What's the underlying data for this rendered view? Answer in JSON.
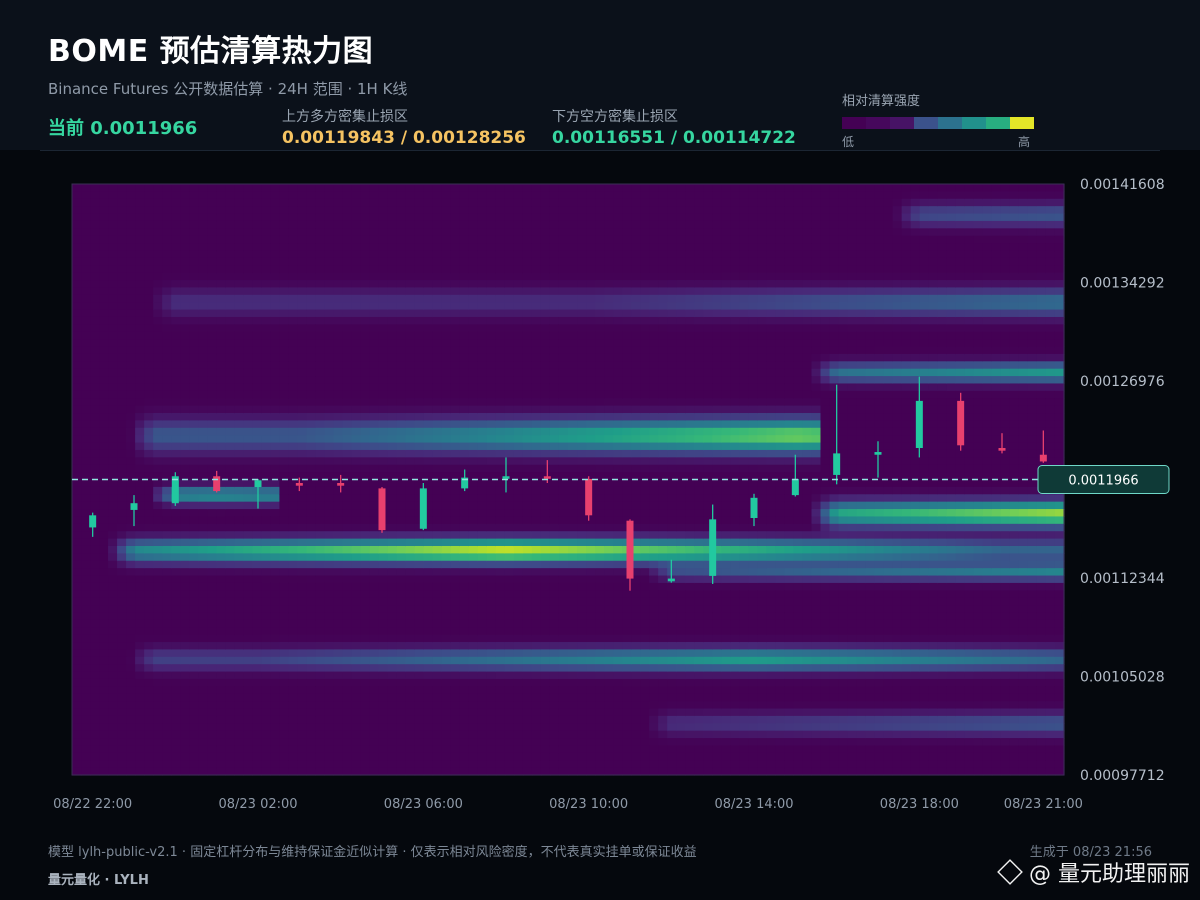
{
  "header": {
    "title": "BOME 预估清算热力图",
    "subtitle": "Binance Futures 公开数据估算 · 24H 范围 · 1H K线",
    "current_label": "当前 0.0011966",
    "upper_label": "上方多方密集止损区",
    "upper_value": "0.00119843 / 0.00128256",
    "lower_label": "下方空方密集止损区",
    "lower_value": "0.00116551 / 0.00114722",
    "legend_label": "相对清算强度",
    "legend_low": "低",
    "legend_high": "高"
  },
  "colors": {
    "up": "#22c9a0",
    "down": "#e8406e",
    "current_line": "#8fe8e0",
    "viridis": [
      "#440154",
      "#482878",
      "#3e4a89",
      "#31688e",
      "#26828e",
      "#1f9e89",
      "#35b779",
      "#6dcd59",
      "#b4de2c",
      "#fde725"
    ]
  },
  "legend_swatches": [
    "#440154",
    "#46085c",
    "#471365",
    "#3b528b",
    "#2c728e",
    "#21918c",
    "#28ae80",
    "#e4e628"
  ],
  "chart_data": {
    "type": "heatmap",
    "title": "BOME 预估清算热力图",
    "ylim": [
      0.00097712,
      0.00141608
    ],
    "y_ticks": [
      "0.00141608",
      "0.00134292",
      "0.00126976",
      "0.00119660",
      "0.00112344",
      "0.00105028",
      "0.00097712"
    ],
    "y_tick_labels_shown": [
      "0.00141608",
      "0.00134292",
      "0.00126976",
      "",
      "0.00112344",
      "0.00105028",
      "0.00097712"
    ],
    "x_tick_labels": [
      "08/22 22:00",
      "08/23 02:00",
      "08/23 06:00",
      "08/23 10:00",
      "08/23 14:00",
      "08/23 18:00",
      "08/23 21:00"
    ],
    "x_tick_hours": [
      0,
      4,
      8,
      12,
      16,
      20,
      23
    ],
    "x_range_hours": [
      -0.5,
      23.5
    ],
    "current_price": 0.0011966,
    "current_price_label": "0.0011966",
    "heat_bands": [
      {
        "price": 0.0011435,
        "x_start": 1,
        "x_end": 24,
        "peak": 10,
        "intensity": 1.0,
        "width": 8.5e-06
      },
      {
        "price": 0.001229,
        "x_start": 1.5,
        "x_end": 17,
        "peak": 17,
        "intensity": 0.85,
        "width": 1.2e-05
      },
      {
        "price": 0.001171,
        "x_start": 18,
        "x_end": 24,
        "peak": 24,
        "intensity": 0.95,
        "width": 9e-06
      },
      {
        "price": 0.001276,
        "x_start": 18,
        "x_end": 24,
        "peak": 24,
        "intensity": 0.6,
        "width": 7e-06
      },
      {
        "price": 0.001063,
        "x_start": 1.5,
        "x_end": 24,
        "peak": 16,
        "intensity": 0.6,
        "width": 8e-06
      },
      {
        "price": 0.001128,
        "x_start": 14,
        "x_end": 24,
        "peak": 24,
        "intensity": 0.5,
        "width": 6e-06
      },
      {
        "price": 0.001328,
        "x_start": 2,
        "x_end": 24,
        "peak": 24,
        "intensity": 0.4,
        "width": 1e-05
      },
      {
        "price": 0.001185,
        "x_start": 2,
        "x_end": 4,
        "peak": 3,
        "intensity": 0.55,
        "width": 6e-06
      },
      {
        "price": 0.001393,
        "x_start": 20,
        "x_end": 24,
        "peak": 24,
        "intensity": 0.3,
        "width": 8e-06
      },
      {
        "price": 0.001015,
        "x_start": 14,
        "x_end": 24,
        "peak": 24,
        "intensity": 0.3,
        "width": 8e-06
      }
    ],
    "candles": [
      {
        "h": 0,
        "o": 0.001161,
        "c": 0.00117,
        "hi": 0.001172,
        "lo": 0.001154
      },
      {
        "h": 1,
        "o": 0.001174,
        "c": 0.001179,
        "hi": 0.001185,
        "lo": 0.001162
      },
      {
        "h": 2,
        "o": 0.001179,
        "c": 0.001199,
        "hi": 0.001202,
        "lo": 0.001177
      },
      {
        "h": 3,
        "o": 0.001199,
        "c": 0.001188,
        "hi": 0.001203,
        "lo": 0.001187
      },
      {
        "h": 4,
        "o": 0.001191,
        "c": 0.001196,
        "hi": 0.001197,
        "lo": 0.001175
      },
      {
        "h": 5,
        "o": 0.001194,
        "c": 0.001192,
        "hi": 0.001198,
        "lo": 0.001188
      },
      {
        "h": 6,
        "o": 0.001194,
        "c": 0.001192,
        "hi": 0.0012,
        "lo": 0.001187
      },
      {
        "h": 7,
        "o": 0.00119,
        "c": 0.001159,
        "hi": 0.001191,
        "lo": 0.001157
      },
      {
        "h": 8,
        "o": 0.00116,
        "c": 0.00119,
        "hi": 0.001194,
        "lo": 0.001159
      },
      {
        "h": 9,
        "o": 0.00119,
        "c": 0.001198,
        "hi": 0.001204,
        "lo": 0.001188
      },
      {
        "h": 10,
        "o": 0.001199,
        "c": 0.001199,
        "hi": 0.001213,
        "lo": 0.001187
      },
      {
        "h": 11,
        "o": 0.001199,
        "c": 0.001198,
        "hi": 0.001211,
        "lo": 0.001194
      },
      {
        "h": 12,
        "o": 0.001197,
        "c": 0.00117,
        "hi": 0.001199,
        "lo": 0.001166
      },
      {
        "h": 13,
        "o": 0.001166,
        "c": 0.001123,
        "hi": 0.001167,
        "lo": 0.001114
      },
      {
        "h": 14,
        "o": 0.001121,
        "c": 0.001123,
        "hi": 0.001137,
        "lo": 0.00112
      },
      {
        "h": 15,
        "o": 0.001125,
        "c": 0.001167,
        "hi": 0.001178,
        "lo": 0.001119
      },
      {
        "h": 16,
        "o": 0.001168,
        "c": 0.001183,
        "hi": 0.001186,
        "lo": 0.001162
      },
      {
        "h": 17,
        "o": 0.001185,
        "c": 0.001197,
        "hi": 0.001215,
        "lo": 0.001184
      },
      {
        "h": 18,
        "o": 0.0012,
        "c": 0.001216,
        "hi": 0.001267,
        "lo": 0.001193
      },
      {
        "h": 19,
        "o": 0.001215,
        "c": 0.001217,
        "hi": 0.001225,
        "lo": 0.001198
      },
      {
        "h": 20,
        "o": 0.00122,
        "c": 0.001255,
        "hi": 0.001273,
        "lo": 0.001213
      },
      {
        "h": 21,
        "o": 0.001255,
        "c": 0.001222,
        "hi": 0.001261,
        "lo": 0.001218
      },
      {
        "h": 22,
        "o": 0.00122,
        "c": 0.001218,
        "hi": 0.001231,
        "lo": 0.001216
      },
      {
        "h": 23,
        "o": 0.001215,
        "c": 0.00121,
        "hi": 0.001233,
        "lo": 0.001209
      }
    ]
  },
  "footer": {
    "note": "模型 lylh-public-v2.1 · 固定杠杆分布与维持保证金近似计算 · 仅表示相对风险密度，不代表真实挂单或保证收益",
    "brand": "量元量化 · LYLH",
    "generated": "生成于 08/23 21:56",
    "watermark": "@ 量元助理丽丽"
  }
}
